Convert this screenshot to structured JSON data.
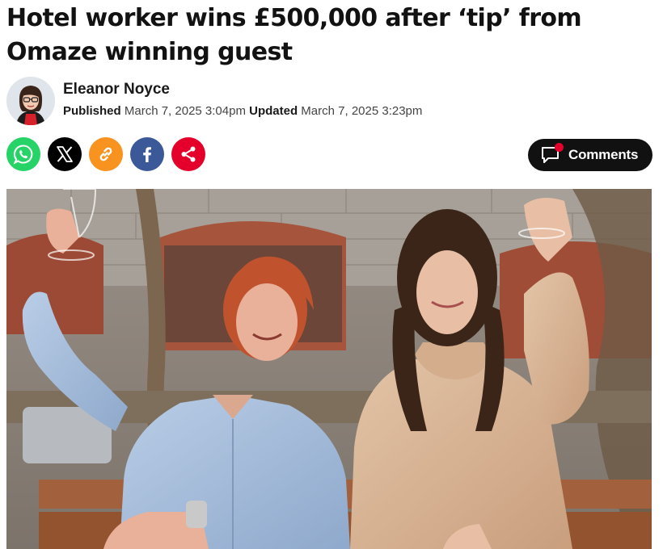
{
  "article": {
    "headline": "Hotel worker wins £500,000 after ‘tip’ from Omaze winning guest",
    "author": "Eleanor Noyce",
    "published_label": "Published",
    "published_date": "March 7, 2025 3:04pm",
    "updated_label": "Updated",
    "updated_date": "March 7, 2025 3:23pm"
  },
  "share": {
    "buttons": [
      {
        "name": "whatsapp",
        "icon": "whatsapp-icon",
        "color": "#25d366"
      },
      {
        "name": "x",
        "icon": "x-logo-icon",
        "color": "#000000"
      },
      {
        "name": "copy-link",
        "icon": "link-icon",
        "color": "#f7931e"
      },
      {
        "name": "facebook",
        "icon": "facebook-icon",
        "color": "#3b5998"
      },
      {
        "name": "share",
        "icon": "share-icon",
        "color": "#e4002b"
      }
    ]
  },
  "comments": {
    "label": "Comments",
    "icon": "comment-bubble-icon",
    "notification_color": "#e4002b"
  },
  "hero_image": {
    "icon": "photo"
  }
}
